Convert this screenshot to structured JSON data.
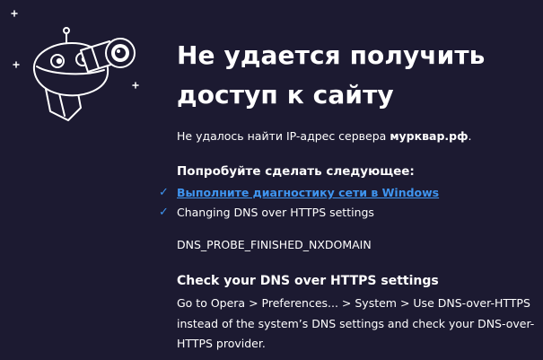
{
  "headline": {
    "line1": "Не удается получить",
    "line2": "доступ к сайту"
  },
  "error_description": {
    "prefix": "Не удалось найти IP-адрес сервера ",
    "host": "мурквар.рф",
    "suffix": "."
  },
  "suggestions": {
    "heading": "Попробуйте сделать следующее:",
    "items": [
      {
        "label": "Выполните диагностику сети в Windows",
        "is_link": true
      },
      {
        "label": "Changing DNS over HTTPS settings",
        "is_link": false
      }
    ]
  },
  "error_code": "DNS_PROBE_FINISHED_NXDOMAIN",
  "doh_section": {
    "heading": "Check your DNS over HTTPS settings",
    "body": "Go to Opera > Preferences... > System > Use DNS-over-HTTPS instead of the system’s DNS settings and check your DNS-over-HTTPS provider."
  },
  "icons": {
    "check": "checkmark-icon",
    "illustration": "astronaut-telescope-illustration"
  },
  "colors": {
    "background": "#1c1a31",
    "text": "#ffffff",
    "link": "#3f95f0"
  }
}
